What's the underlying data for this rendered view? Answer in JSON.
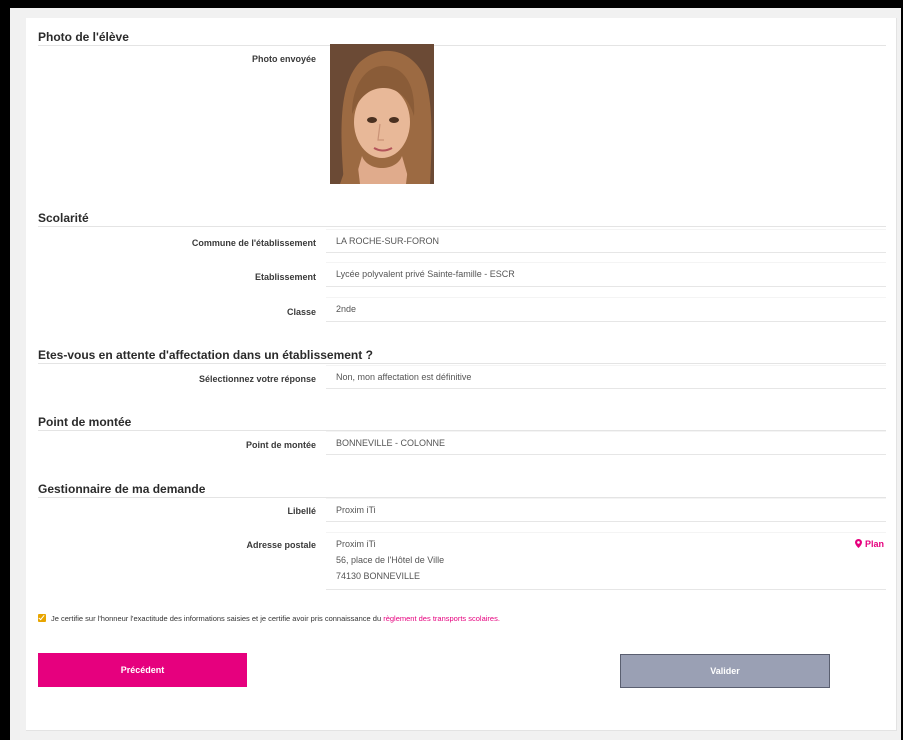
{
  "photo_section": {
    "title": "Photo de l'élève",
    "label": "Photo envoyée"
  },
  "scolarite": {
    "title": "Scolarité",
    "fields": [
      {
        "label": "Commune de l'établissement",
        "value": "LA ROCHE-SUR-FORON"
      },
      {
        "label": "Etablissement",
        "value": "Lycée polyvalent privé Sainte-famille - ESCR"
      },
      {
        "label": "Classe",
        "value": "2nde"
      }
    ]
  },
  "affectation": {
    "title": "Etes-vous en attente d'affectation dans un établissement ?",
    "label": "Sélectionnez votre réponse",
    "value": "Non, mon affectation est définitive"
  },
  "montee": {
    "title": "Point de montée",
    "label": "Point de montée",
    "value": "BONNEVILLE - COLONNE"
  },
  "gestionnaire": {
    "title": "Gestionnaire de ma demande",
    "libelle_label": "Libellé",
    "libelle_value": "Proxim iTi",
    "adresse_label": "Adresse postale",
    "adresse_lines": [
      "Proxim iTi",
      "56, place de l'Hôtel de Ville",
      "74130 BONNEVILLE"
    ],
    "plan_label": "Plan"
  },
  "certification": {
    "text": "Je certifie sur l'honneur l'exactitude des informations saisies et je certifie avoir pris connaissance du ",
    "link": "règlement des transports scolaires",
    "suffix": ".",
    "checked": true
  },
  "buttons": {
    "previous": "Précédent",
    "validate": "Valider"
  },
  "colors": {
    "accent": "#e6007e",
    "validate": "#9aa0b4",
    "checkbox": "#e8a500"
  }
}
